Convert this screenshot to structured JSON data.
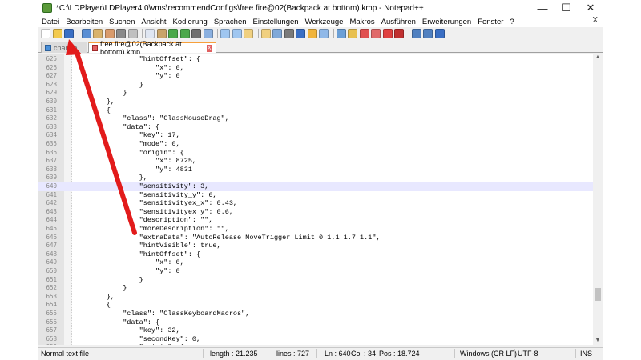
{
  "window": {
    "title": "*C:\\LDPlayer\\LDPlayer4.0\\vms\\recommendConfigs\\free fire@02(Backpack at bottom).kmp - Notepad++",
    "controls": {
      "minimize": "—",
      "maximize": "☐",
      "close": "✕"
    }
  },
  "menu": {
    "items": [
      "Datei",
      "Bearbeiten",
      "Suchen",
      "Ansicht",
      "Kodierung",
      "Sprachen",
      "Einstellungen",
      "Werkzeuge",
      "Makros",
      "Ausführen",
      "Erweiterungen",
      "Fenster",
      "?"
    ],
    "close": "X"
  },
  "toolbar": {
    "buttons": [
      {
        "icon": "new-file-icon",
        "color": "#ffffff"
      },
      {
        "icon": "open-file-icon",
        "color": "#f2c94c"
      },
      {
        "icon": "save-icon",
        "color": "#3a6fc4"
      },
      {
        "icon": "save-all-icon",
        "color": "#5a8fd4"
      },
      {
        "icon": "close-icon",
        "color": "#d9b36c"
      },
      {
        "icon": "close-all-icon",
        "color": "#d99b6c"
      },
      {
        "icon": "print-icon",
        "color": "#8a8a8a"
      },
      {
        "icon": "cut-icon",
        "color": "#c0c0c0"
      },
      {
        "icon": "copy-icon",
        "color": "#dfe6f2"
      },
      {
        "icon": "paste-icon",
        "color": "#c9a46a"
      },
      {
        "icon": "undo-icon",
        "color": "#4aa84a"
      },
      {
        "icon": "redo-icon",
        "color": "#4aa84a"
      },
      {
        "icon": "find-icon",
        "color": "#707070"
      },
      {
        "icon": "replace-icon",
        "color": "#8ab0e0"
      },
      {
        "icon": "zoom-in-icon",
        "color": "#9fc6f0"
      },
      {
        "icon": "zoom-out-icon",
        "color": "#9fc6f0"
      },
      {
        "icon": "sync-vertical-icon",
        "color": "#f0d080"
      },
      {
        "icon": "sync-horizontal-icon",
        "color": "#f0d080"
      },
      {
        "icon": "word-wrap-icon",
        "color": "#7fa8d8"
      },
      {
        "icon": "show-all-chars-icon",
        "color": "#7a7a7a"
      },
      {
        "icon": "indent-guide-icon",
        "color": "#3a6fc4"
      },
      {
        "icon": "language-icon",
        "color": "#f0b43c"
      },
      {
        "icon": "doc-map-icon",
        "color": "#8fb8e8"
      },
      {
        "icon": "function-list-icon",
        "color": "#6b9fd6"
      },
      {
        "icon": "folder-workspace-icon",
        "color": "#e8c050"
      },
      {
        "icon": "monitoring-icon",
        "color": "#e05050"
      },
      {
        "icon": "eye-icon",
        "color": "#e06a6a"
      },
      {
        "icon": "record-macro-icon",
        "color": "#e04040"
      },
      {
        "icon": "stop-macro-icon",
        "color": "#c03030"
      },
      {
        "icon": "play-macro-icon",
        "color": "#5080c0"
      },
      {
        "icon": "run-macro-multiple-icon",
        "color": "#5080c0"
      },
      {
        "icon": "save-macro-icon",
        "color": "#3a6fc4"
      }
    ]
  },
  "tabs": [
    {
      "label": "change",
      "active": false
    },
    {
      "label": "free fire@02(Backpack at bottom).kmp",
      "active": true,
      "close": "X"
    }
  ],
  "editor": {
    "current_line": 640,
    "lines": [
      {
        "n": "625",
        "t": "                \"hintOffset\": {"
      },
      {
        "n": "626",
        "t": "                    \"x\": 0,"
      },
      {
        "n": "627",
        "t": "                    \"y\": 0"
      },
      {
        "n": "628",
        "t": "                }"
      },
      {
        "n": "629",
        "t": "            }"
      },
      {
        "n": "630",
        "t": "        },"
      },
      {
        "n": "631",
        "t": "        {"
      },
      {
        "n": "632",
        "t": "            \"class\": \"ClassMouseDrag\","
      },
      {
        "n": "633",
        "t": "            \"data\": {"
      },
      {
        "n": "634",
        "t": "                \"key\": 17,"
      },
      {
        "n": "635",
        "t": "                \"mode\": 0,"
      },
      {
        "n": "636",
        "t": "                \"origin\": {"
      },
      {
        "n": "637",
        "t": "                    \"x\": 8725,"
      },
      {
        "n": "638",
        "t": "                    \"y\": 4831"
      },
      {
        "n": "639",
        "t": "                },"
      },
      {
        "n": "640",
        "t": "                \"sensitivity\": 3,"
      },
      {
        "n": "641",
        "t": "                \"sensitivity_y\": 6,"
      },
      {
        "n": "642",
        "t": "                \"sensitivityex_x\": 0.43,"
      },
      {
        "n": "643",
        "t": "                \"sensitivityex_y\": 0.6,"
      },
      {
        "n": "644",
        "t": "                \"description\": \"\","
      },
      {
        "n": "645",
        "t": "                \"moreDescription\": \"\","
      },
      {
        "n": "646",
        "t": "                \"extraData\": \"AutoRelease MoveTrigger Limit 0 1.1 1.7 1.1\","
      },
      {
        "n": "647",
        "t": "                \"hintVisible\": true,"
      },
      {
        "n": "648",
        "t": "                \"hintOffset\": {"
      },
      {
        "n": "649",
        "t": "                    \"x\": 0,"
      },
      {
        "n": "650",
        "t": "                    \"y\": 0"
      },
      {
        "n": "651",
        "t": "                }"
      },
      {
        "n": "652",
        "t": "            }"
      },
      {
        "n": "653",
        "t": "        },"
      },
      {
        "n": "654",
        "t": "        {"
      },
      {
        "n": "655",
        "t": "            \"class\": \"ClassKeyboardMacros\","
      },
      {
        "n": "656",
        "t": "            \"data\": {"
      },
      {
        "n": "657",
        "t": "                \"key\": 32,"
      },
      {
        "n": "658",
        "t": "                \"secondKey\": 0,"
      },
      {
        "n": "659",
        "t": "                \"origin\": {"
      }
    ]
  },
  "scrollbar": {
    "up": "▲",
    "down": "▼"
  },
  "status": {
    "file_type": "Normal text file",
    "length": "length : 21.235",
    "lines": "lines : 727",
    "ln": "Ln : 640",
    "col": "Col : 34",
    "pos": "Pos : 18.724",
    "eol": "Windows (CR LF)",
    "encoding": "UTF-8",
    "mode": "INS"
  },
  "colors": {
    "annotation_arrow": "#e21b1b",
    "current_line": "#e8e8ff",
    "active_tab_accent": "#f7a03c"
  }
}
